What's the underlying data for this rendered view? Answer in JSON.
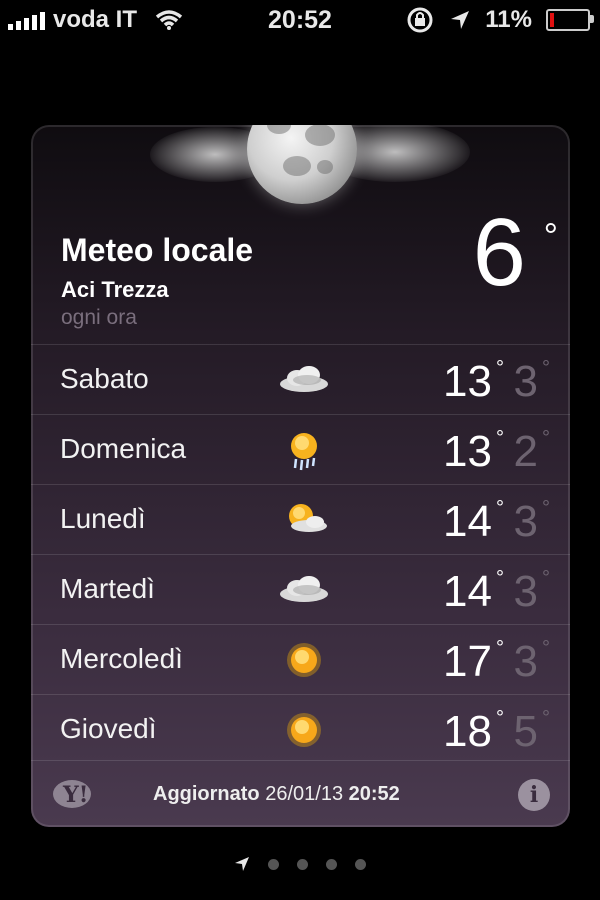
{
  "status_bar": {
    "carrier": "voda IT",
    "time": "20:52",
    "battery_percent": "11%",
    "battery_level": 0.11,
    "icons": [
      "signal-icon",
      "wifi-icon",
      "rotation-lock-icon",
      "location-arrow-icon",
      "battery-icon"
    ]
  },
  "header": {
    "title": "Meteo locale",
    "city": "Aci Trezza",
    "subtitle": "ogni ora",
    "current_temp": "6",
    "degree": "°",
    "condition_icon": "moon-cloud-icon"
  },
  "forecast": [
    {
      "day": "Sabato",
      "icon": "cloud-icon",
      "hi": "13",
      "lo": "3"
    },
    {
      "day": "Domenica",
      "icon": "rain-sun-icon",
      "hi": "13",
      "lo": "2"
    },
    {
      "day": "Lunedì",
      "icon": "sun-cloud-icon",
      "hi": "14",
      "lo": "3"
    },
    {
      "day": "Martedì",
      "icon": "cloud-icon",
      "hi": "14",
      "lo": "3"
    },
    {
      "day": "Mercoledì",
      "icon": "sun-icon",
      "hi": "17",
      "lo": "3"
    },
    {
      "day": "Giovedì",
      "icon": "sun-icon",
      "hi": "18",
      "lo": "5"
    }
  ],
  "footer": {
    "updated_label": "Aggiornato",
    "updated_date": "26/01/13",
    "updated_time": "20:52",
    "info_label": "i",
    "yahoo_label": "Y!"
  },
  "pager": {
    "pages": 5,
    "active": 0
  }
}
